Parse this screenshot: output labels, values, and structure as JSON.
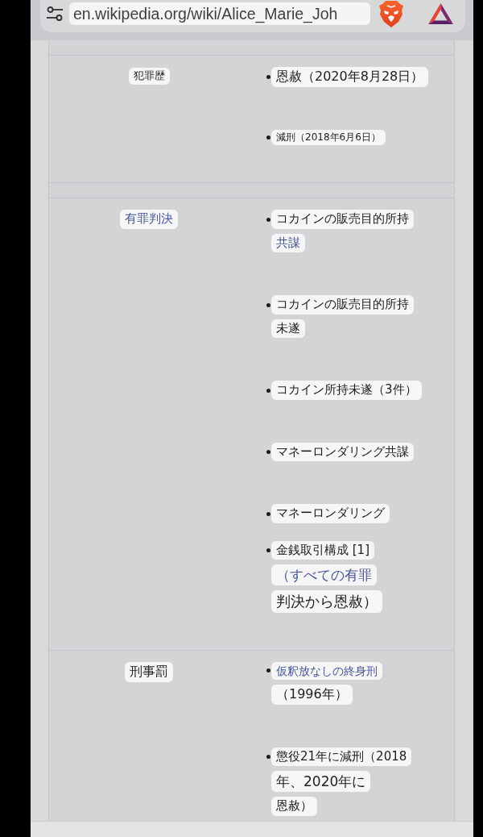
{
  "browser": {
    "url": "en.wikipedia.org/wiki/Alice_Marie_Joh"
  },
  "infobox": {
    "rows": [
      {
        "label": {
          "text": "犯罪歴",
          "link": false
        },
        "values": [
          {
            "lines": [
              {
                "text": "恩赦（2020年8月28日）",
                "link": false
              }
            ]
          },
          {
            "lines": [
              {
                "text": "減刑（2018年6月6日）",
                "link": false
              }
            ]
          }
        ]
      },
      {
        "label": {
          "text": "有罪判決",
          "link": true
        },
        "values": [
          {
            "lines": [
              {
                "text": "コカインの販売目的所持",
                "link": false
              },
              {
                "text": "共謀",
                "link": true
              }
            ]
          },
          {
            "lines": [
              {
                "text": "コカインの販売目的所持",
                "link": false
              },
              {
                "text": "未遂",
                "link": false
              }
            ]
          },
          {
            "lines": [
              {
                "text": "コカイン所持未遂（3件）",
                "link": false
              }
            ]
          },
          {
            "lines": [
              {
                "text": "マネーロンダリング共謀",
                "link": false
              }
            ]
          },
          {
            "lines": [
              {
                "text": "マネーロンダリング",
                "link": false
              }
            ]
          },
          {
            "lines": [
              {
                "text": "金銭取引構成 [1]",
                "link": false
              },
              {
                "text": "（すべての有罪",
                "link": true
              },
              {
                "text": "判決から恩赦）",
                "link": false
              }
            ]
          }
        ]
      },
      {
        "label": {
          "text": "刑事罰",
          "link": false
        },
        "values": [
          {
            "lines": [
              {
                "text": "仮釈放なしの終身刑",
                "link": true
              },
              {
                "text": "（1996年）",
                "link": false
              }
            ]
          },
          {
            "lines": [
              {
                "text": "懲役21年に減刑（2018",
                "link": false
              },
              {
                "text": "年、2020年に",
                "link": false
              },
              {
                "text": "恩赦）",
                "link": false
              }
            ]
          }
        ]
      }
    ]
  }
}
